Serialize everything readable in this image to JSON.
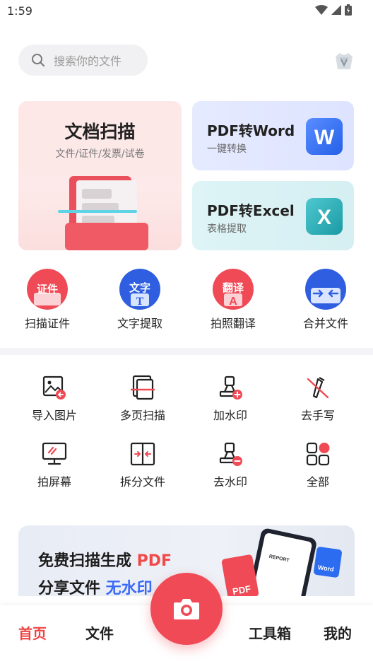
{
  "status_bar": {
    "time": "1:59"
  },
  "search": {
    "placeholder": "搜索你的文件"
  },
  "scan_card": {
    "title": "文档扫描",
    "subtitle": "文件/证件/发票/试卷"
  },
  "word_card": {
    "title": "PDF转Word",
    "subtitle": "一键转换",
    "icon_letter": "W"
  },
  "excel_card": {
    "title": "PDF转Excel",
    "subtitle": "表格提取",
    "icon_letter": "X"
  },
  "quick_actions": [
    {
      "label": "扫描证件",
      "badge": "证件"
    },
    {
      "label": "文字提取",
      "badge": "文字"
    },
    {
      "label": "拍照翻译",
      "badge": "翻译"
    },
    {
      "label": "合并文件"
    }
  ],
  "tools": [
    {
      "label": "导入图片"
    },
    {
      "label": "多页扫描"
    },
    {
      "label": "加水印"
    },
    {
      "label": "去手写"
    },
    {
      "label": "拍屏幕"
    },
    {
      "label": "拆分文件"
    },
    {
      "label": "去水印"
    },
    {
      "label": "全部"
    }
  ],
  "banner": {
    "line1_prefix": "免费扫描生成 ",
    "line1_accent": "PDF",
    "line2_prefix": "分享文件 ",
    "line2_accent": "无水印",
    "doc_title": "REPORT",
    "pdf_tag": "PDF",
    "word_tag": "Word"
  },
  "bottom_nav": {
    "home": "首页",
    "files": "文件",
    "toolbox": "工具箱",
    "mine": "我的"
  },
  "colors": {
    "accent": "#ef4444",
    "brand_red": "#ef4a55",
    "word_blue": "#2b6cf0",
    "excel_teal": "#1fa5b0"
  }
}
